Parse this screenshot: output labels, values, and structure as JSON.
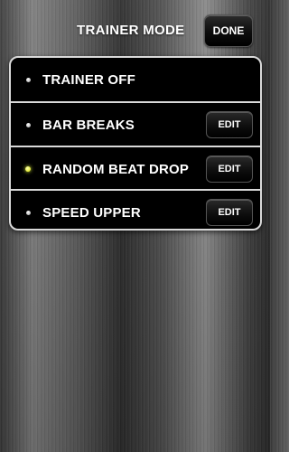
{
  "header": {
    "title": "TRAINER MODE",
    "done_label": "DONE"
  },
  "modes": [
    {
      "label": "TRAINER OFF",
      "selected": false,
      "edit_label": null
    },
    {
      "label": "BAR BREAKS",
      "selected": false,
      "edit_label": "EDIT"
    },
    {
      "label": "RANDOM BEAT DROP",
      "selected": true,
      "edit_label": "EDIT"
    },
    {
      "label": "SPEED UPPER",
      "selected": false,
      "edit_label": "EDIT"
    }
  ],
  "colors": {
    "selected_indicator": "#d9e000",
    "list_border": "#d9d9d9"
  }
}
